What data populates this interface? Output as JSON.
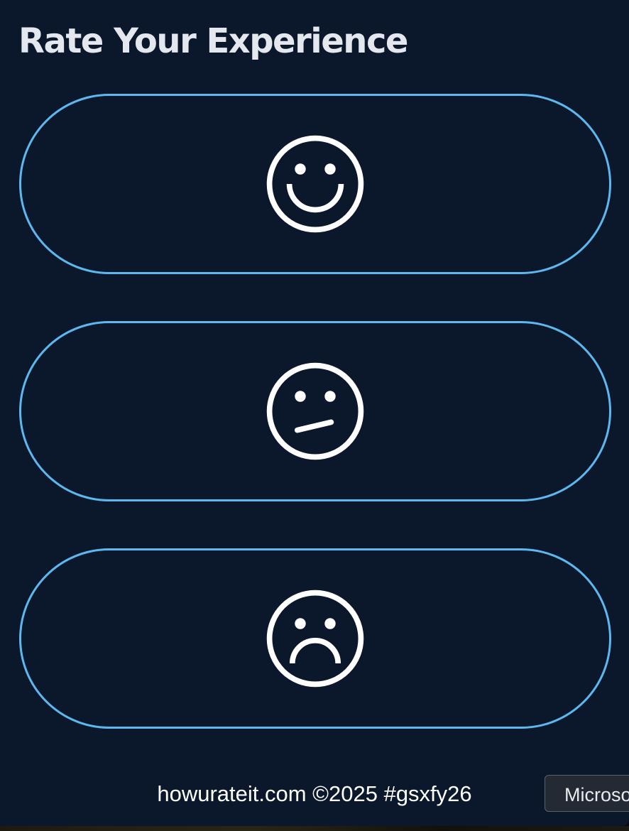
{
  "page": {
    "title": "Rate Your Experience"
  },
  "ratings": [
    {
      "label": "Happy",
      "icon": "happy-face-icon"
    },
    {
      "label": "Neutral",
      "icon": "neutral-face-icon"
    },
    {
      "label": "Sad",
      "icon": "sad-face-icon"
    }
  ],
  "footer": {
    "text": "howurateit.com ©2025 #gsxfy26"
  },
  "tooltip": {
    "text": "Microsoft"
  },
  "colors": {
    "background": "#0b172b",
    "button_border": "#5cb8ef",
    "icon": "#ffffff",
    "title": "#e4e7ee"
  }
}
